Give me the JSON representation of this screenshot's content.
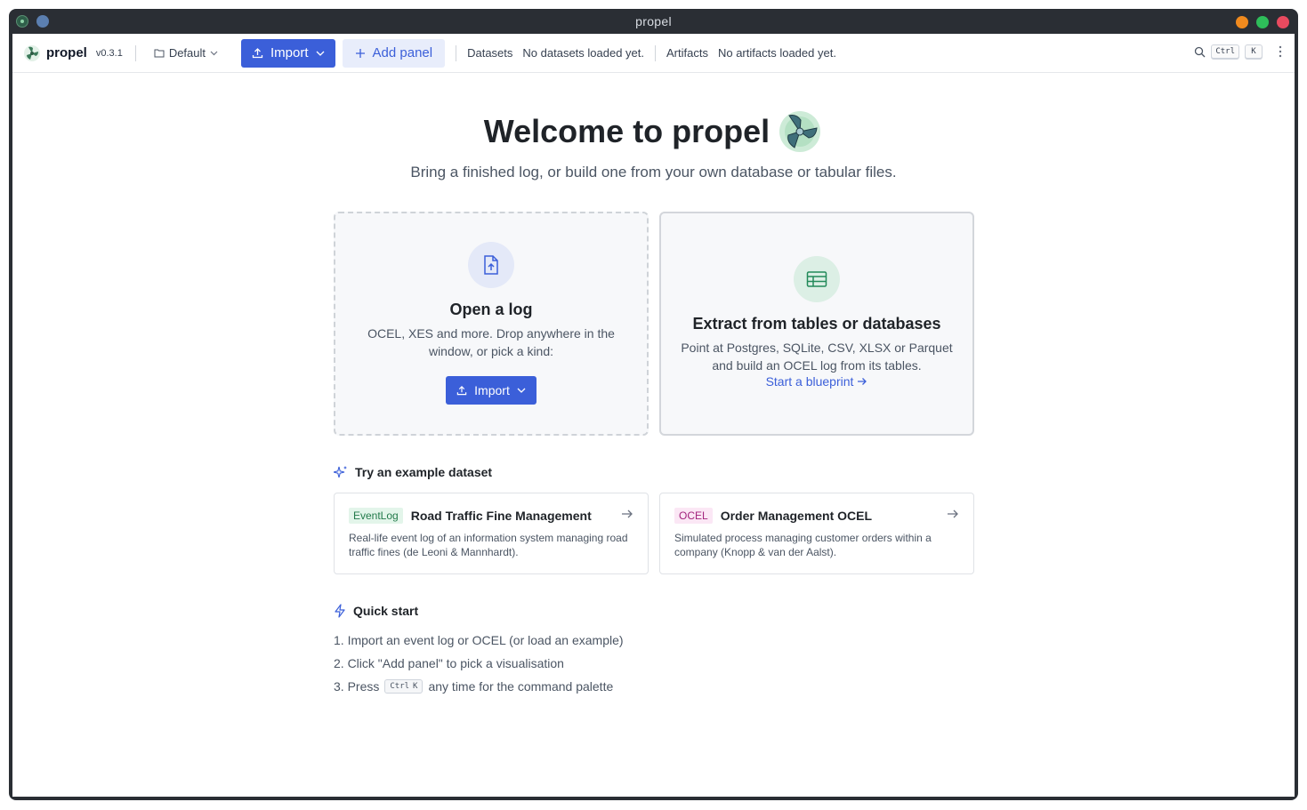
{
  "window": {
    "title": "propel"
  },
  "toolbar": {
    "brand": "propel",
    "version": "v0.3.1",
    "workspace": "Default",
    "import_label": "Import",
    "add_panel_label": "Add panel",
    "datasets_label": "Datasets",
    "datasets_value": "No datasets loaded yet.",
    "artifacts_label": "Artifacts",
    "artifacts_value": "No artifacts loaded yet.",
    "shortcut_ctrl": "Ctrl",
    "shortcut_k": "K"
  },
  "hero": {
    "title": "Welcome to propel",
    "subtitle": "Bring a finished log, or build one from your own database or tabular files."
  },
  "open_card": {
    "title": "Open a log",
    "description": "OCEL, XES and more. Drop anywhere in the window, or pick a kind:",
    "button": "Import"
  },
  "extract_card": {
    "title": "Extract from tables or databases",
    "description": "Point at Postgres, SQLite, CSV, XLSX or Parquet and build an OCEL log from its tables.",
    "link": "Start a blueprint"
  },
  "examples": {
    "heading": "Try an example dataset",
    "items": [
      {
        "badge": "EventLog",
        "title": "Road Traffic Fine Management",
        "description": "Real-life event log of an information system managing road traffic fines (de Leoni & Mannhardt)."
      },
      {
        "badge": "OCEL",
        "title": "Order Management OCEL",
        "description": "Simulated process managing customer orders within a company (Knopp & van der Aalst)."
      }
    ]
  },
  "quickstart": {
    "heading": "Quick start",
    "step1": "1. Import an event log or OCEL (or load an example)",
    "step2": "2. Click \"Add panel\" to pick a visualisation",
    "step3_pre": "3. Press",
    "step3_kbd1": "Ctrl",
    "step3_kbd2": "K",
    "step3_post": "any time for the command palette"
  },
  "colors": {
    "accent": "#3b5fd9",
    "titlebar": "#2a2e34",
    "eventlog_badge": "#237a4b",
    "ocel_badge": "#a3247e"
  }
}
